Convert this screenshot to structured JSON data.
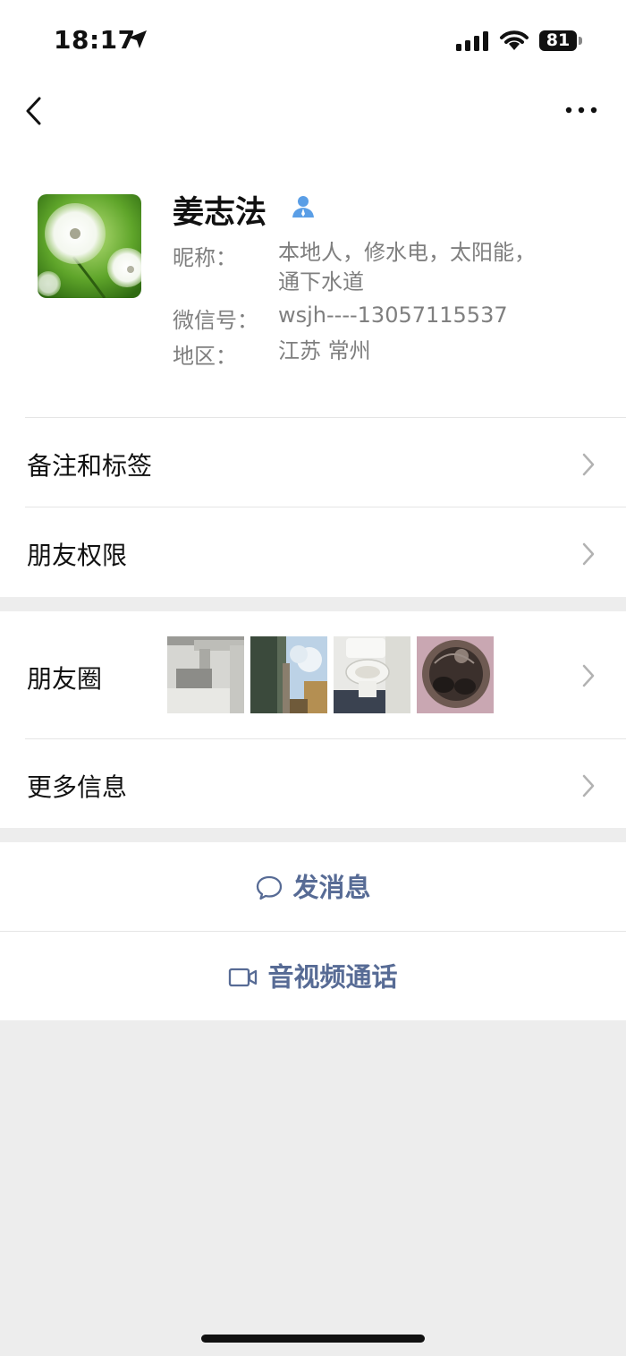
{
  "status_bar": {
    "time": "18:17",
    "battery": "81"
  },
  "profile": {
    "name": "姜志法",
    "nickname_label": "昵称：",
    "nickname_line1": "本地人，修水电，太阳能，",
    "nickname_line2": "通下水道",
    "wechat_id_label": "微信号：",
    "wechat_id": "wsjh----13057115537",
    "region_label": "地区：",
    "region": "江苏 常州"
  },
  "menu": {
    "remarks_tags": "备注和标签",
    "friend_permissions": "朋友权限",
    "moments": "朋友圈",
    "more_info": "更多信息"
  },
  "actions": {
    "send_message": "发消息",
    "video_call": "音视频通话"
  },
  "colors": {
    "link": "#576b95",
    "background": "#ededed"
  }
}
